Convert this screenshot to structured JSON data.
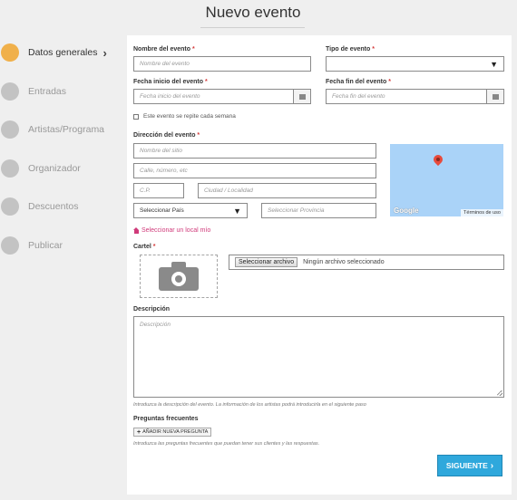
{
  "page_title": "Nuevo evento",
  "steps": [
    {
      "label": "Datos generales",
      "active": true
    },
    {
      "label": "Entradas",
      "active": false
    },
    {
      "label": "Artistas/Programa",
      "active": false
    },
    {
      "label": "Organizador",
      "active": false
    },
    {
      "label": "Descuentos",
      "active": false
    },
    {
      "label": "Publicar",
      "active": false
    }
  ],
  "form": {
    "event_name": {
      "label": "Nombre del evento",
      "required_mark": "*",
      "placeholder": "Nombre del evento"
    },
    "event_type": {
      "label": "Tipo de evento",
      "required_mark": "*",
      "value": ""
    },
    "start_date": {
      "label": "Fecha inicio del evento",
      "required_mark": "*",
      "placeholder": "Fecha inicio del evento"
    },
    "end_date": {
      "label": "Fecha fin del evento",
      "required_mark": "*",
      "placeholder": "Fecha fin del evento"
    },
    "weekly_repeat": {
      "label": "Este evento se repite cada semana",
      "checked": false
    },
    "address": {
      "label": "Dirección del evento",
      "required_mark": "*",
      "site_placeholder": "Nombre del sitio",
      "street_placeholder": "Calle, número, etc",
      "postal_placeholder": "C.P.",
      "city_placeholder": "Ciudad / Localidad",
      "country_value": "Seleccionar País",
      "province_placeholder": "Seleccionar Provincia"
    },
    "map": {
      "brand": "Google",
      "terms": "Términos de uso"
    },
    "select_local_link": "Seleccionar un local mío",
    "poster": {
      "label": "Cartel",
      "required_mark": "*",
      "file_button": "Seleccionar archivo",
      "file_status": "Ningún archivo seleccionado"
    },
    "description": {
      "label": "Descripción",
      "placeholder": "Descripción",
      "help": "Introduzca la descripción del evento. La información de los artistas podrá introducirla en el siguiente paso"
    },
    "faq": {
      "label": "Preguntas frecuentes",
      "add_button": "AÑADIR NUEVA PREGUNTA",
      "help": "Introduzca las preguntas frecuentes que puedan tener sus clientes y las respuestas."
    },
    "next_button": "SIGUIENTE"
  },
  "colors": {
    "active_step": "#f0b04a",
    "inactive_step": "#c3c3c3",
    "required": "#d43a3a",
    "link": "#d03a7a",
    "primary_button": "#2fa8dc",
    "map_water": "#aad3f8"
  },
  "icons": {
    "active_step_chevron": "chevron-right-icon",
    "calendar": "calendar-icon",
    "dropdown": "caret-down-icon",
    "home": "home-icon",
    "camera": "camera-icon",
    "map_pin": "map-pin-icon",
    "add": "plus-icon"
  }
}
